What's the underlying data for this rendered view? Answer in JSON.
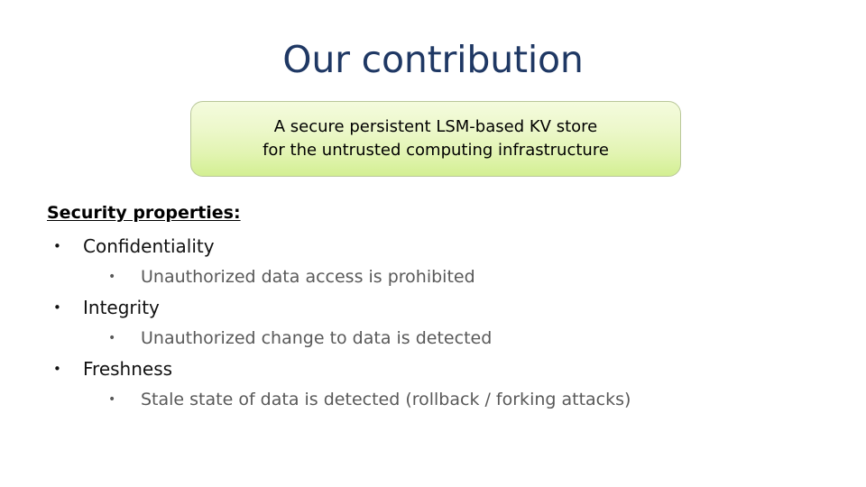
{
  "slide": {
    "title": "Our contribution",
    "title_color": "#1f3864",
    "background_color": "#ffffff",
    "callout": {
      "line1": "A secure persistent LSM-based KV store",
      "line2": "for the untrusted computing infrastructure",
      "fill_top_color": "#f4fbdd",
      "fill_bottom_color": "#d3ef92",
      "border_color": "#b9c79a",
      "text_color": "#000000"
    },
    "body": {
      "heading": "Security properties:",
      "bullet_glyph": "•",
      "sub_text_color": "#595959",
      "items": [
        {
          "label": "Confidentiality",
          "detail": "Unauthorized data access is prohibited"
        },
        {
          "label": "Integrity",
          "detail": "Unauthorized change to data is detected"
        },
        {
          "label": "Freshness",
          "detail": "Stale state of data is detected (rollback / forking attacks)"
        }
      ]
    }
  }
}
